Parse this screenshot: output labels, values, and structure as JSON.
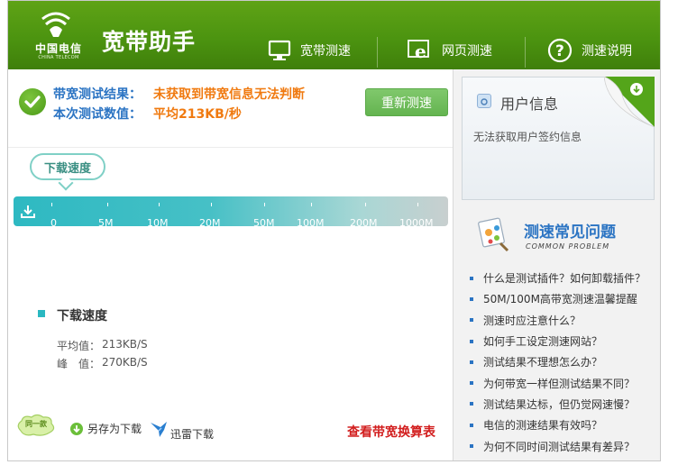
{
  "header": {
    "logo_cn": "中国电信",
    "logo_en": "CHINA TELECOM",
    "title": "宽带助手",
    "nav": [
      {
        "label": "宽带测速",
        "icon": "monitor-icon"
      },
      {
        "label": "网页测速",
        "icon": "browser-e-icon"
      },
      {
        "label": "测速说明",
        "icon": "question-icon"
      }
    ]
  },
  "result": {
    "label1": "带宽测试结果：",
    "value1": "未获取到带宽信息无法判断",
    "label2": "本次测试数值：",
    "value2": "平均213KB/秒",
    "retest_label": "重新测速"
  },
  "speed": {
    "bubble_label": "下载速度",
    "scale_ticks": [
      "0",
      "5M",
      "10M",
      "20M",
      "50M",
      "100M",
      "200M",
      "1000M"
    ],
    "legend_label": "下载速度",
    "avg_label": "平均值：",
    "avg_value": "213KB/S",
    "peak_label": "峰　值：",
    "peak_value": "270KB/S"
  },
  "bottom": {
    "badge_text": "同一款",
    "save_as": "另存为下载",
    "thunder": "迅雷下载",
    "calc_link": "查看带宽换算表"
  },
  "user_info": {
    "title": "用户信息",
    "message": "无法获取用户签约信息"
  },
  "faq": {
    "title": "测速常见问题",
    "subtitle": "COMMON PROBLEM",
    "items": [
      "什么是测试插件？如何卸载插件？",
      "50M/100M高带宽测速温馨提醒",
      "测速时应注意什么？",
      "如何手工设定测速网站？",
      "测试结果不理想怎么办？",
      "为何带宽一样但测试结果不同？",
      "测试结果达标，但仍觉网速慢？",
      "电信的测速结果有效吗？",
      "为何不同时间测试结果有差异？"
    ]
  },
  "colors": {
    "header_green": "#4c9410",
    "link_blue": "#2b74c3",
    "warn_orange": "#f07a10",
    "scale_teal": "#2eb9c2",
    "calc_red": "#d21e1e"
  }
}
